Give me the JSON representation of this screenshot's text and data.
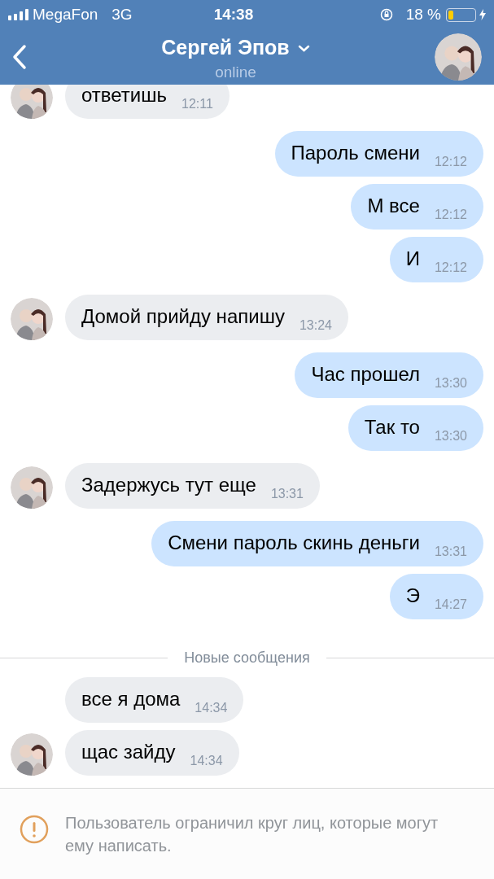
{
  "status_bar": {
    "carrier": "MegaFon",
    "network": "3G",
    "time": "14:38",
    "battery": "18 %"
  },
  "header": {
    "name": "Сергей Эпов",
    "status": "online"
  },
  "messages": [
    {
      "kind": "incoming",
      "text": "ответишь",
      "time": "12:11",
      "avatar": true
    },
    {
      "kind": "outgoing",
      "text": "Пароль смени",
      "time": "12:12"
    },
    {
      "kind": "outgoing",
      "text": "М все",
      "time": "12:12"
    },
    {
      "kind": "outgoing",
      "text": "И",
      "time": "12:12"
    },
    {
      "kind": "incoming",
      "text": "Домой прийду напишу",
      "time": "13:24",
      "avatar": true
    },
    {
      "kind": "outgoing",
      "text": "Час прошел",
      "time": "13:30"
    },
    {
      "kind": "outgoing",
      "text": "Так то",
      "time": "13:30"
    },
    {
      "kind": "incoming",
      "text": "Задержусь тут еще",
      "time": "13:31",
      "avatar": true
    },
    {
      "kind": "outgoing",
      "text": "Смени пароль скинь деньги",
      "time": "13:31"
    },
    {
      "kind": "outgoing",
      "text": "Э",
      "time": "14:27"
    },
    {
      "kind": "divider",
      "text": "Новые сообщения"
    },
    {
      "kind": "incoming",
      "text": "все я дома",
      "time": "14:34",
      "avatar": false
    },
    {
      "kind": "incoming",
      "text": "щас зайду",
      "time": "14:34",
      "avatar": true
    }
  ],
  "notice": {
    "text": "Пользователь ограничил круг лиц, которые могут ему написать."
  }
}
